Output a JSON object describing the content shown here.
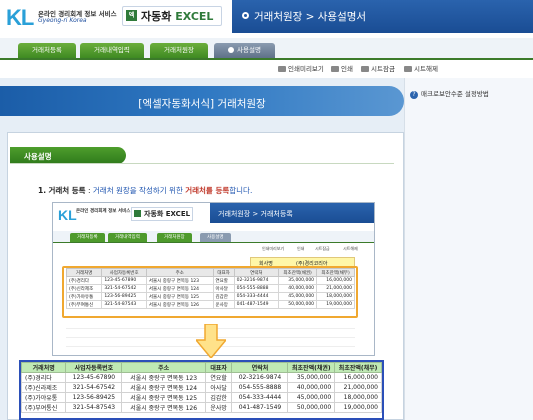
{
  "header": {
    "logo": "KL",
    "tagline": "온라인 경리회계 정보 서비스",
    "sub": "Gyeong-ri Korea",
    "app_icon": "엑",
    "app_name_prefix": "자동화",
    "app_name_accent": "EXCEL",
    "breadcrumb": "거래처원장 > 사용설명서"
  },
  "tabs": [
    {
      "label": "거래처등록"
    },
    {
      "label": "거래내역입력"
    },
    {
      "label": "거래처원장"
    },
    {
      "label": "사용설명"
    }
  ],
  "toolbar": [
    {
      "label": "인쇄미리보기",
      "icon": "print-preview-icon"
    },
    {
      "label": "인쇄",
      "icon": "print-icon"
    },
    {
      "label": "시트잠금",
      "icon": "lock-icon"
    },
    {
      "label": "시트해제",
      "icon": "unlock-icon"
    }
  ],
  "banner_title": "[엑셀자동화서식] 거래처원장",
  "section_label": "사용설명",
  "step": {
    "number": "1.",
    "title": "거래처 등록",
    "colon": " : ",
    "desc_blue": "거래처 원장을 작성하기 위한 ",
    "desc_red": "거래처를 등록",
    "desc_end": "합니다."
  },
  "shot": {
    "logo": "KL",
    "tagline": "온라인 경리회계 정보 서비스",
    "app_name": "자동화 EXCEL",
    "title": "거래처원장 > 거래처등록",
    "tabs": [
      "거래처등록",
      "거래내역입력",
      "거래처원장",
      "사용설명"
    ],
    "tools": [
      "인쇄미리보기",
      "인쇄",
      "시트잠금",
      "시트해제"
    ],
    "company_label": "회사명",
    "company_value": "(주)경리코리아"
  },
  "small_table": {
    "headers": [
      "거래처명",
      "사업자등록번호",
      "주소",
      "대표자",
      "연락처",
      "최초잔액(채권)",
      "최초잔액(채무)"
    ],
    "rows": [
      [
        "(주)경리다",
        "123-45-67890",
        "서울시 중랑구 면목동 123",
        "연요할",
        "02-3216-9874",
        "35,000,000",
        "16,000,000"
      ],
      [
        "(주)신라제조",
        "321-54-67542",
        "서울시 중랑구 면목동 124",
        "아사달",
        "054-555-8888",
        "40,000,000",
        "21,000,000"
      ],
      [
        "(주)가야유통",
        "123-56-89425",
        "서울시 중랑구 면목동 125",
        "김갑한",
        "054-333-4444",
        "45,000,000",
        "18,000,000"
      ],
      [
        "(주)부여통신",
        "321-54-87543",
        "서울시 중랑구 면목동 126",
        "운사망",
        "041-487-1549",
        "50,000,000",
        "19,000,000"
      ]
    ]
  },
  "big_table": {
    "headers": [
      "거래처명",
      "사업자등록번호",
      "주소",
      "대표자",
      "연락처",
      "최초잔액(채권)",
      "최초잔액(채무)"
    ],
    "rows": [
      [
        "(주)경리다",
        "123-45-67890",
        "서울시 중랑구 면목동 123",
        "연요할",
        "02-3216-9874",
        "35,000,000",
        "16,000,000"
      ],
      [
        "(주)신라제조",
        "321-54-67542",
        "서울시 중랑구 면목동 124",
        "아사달",
        "054-555-8888",
        "40,000,000",
        "21,000,000"
      ],
      [
        "(주)가야유통",
        "123-56-89425",
        "서울시 중랑구 면목동 125",
        "김갑한",
        "054-333-4444",
        "45,000,000",
        "18,000,000"
      ],
      [
        "(주)부여통신",
        "321-54-87543",
        "서울시 중랑구 면목동 126",
        "운사망",
        "041-487-1549",
        "50,000,000",
        "19,000,000"
      ]
    ]
  },
  "sidebar": {
    "help_icon": "?",
    "help_label": "매크로보안수준 설정방법"
  },
  "colors": {
    "header_blue": "#1a4d94",
    "tab_green": "#3e8a22",
    "highlight_orange": "#f0a830",
    "result_border": "#2b4fb8",
    "result_header": "#bfe9b4"
  }
}
